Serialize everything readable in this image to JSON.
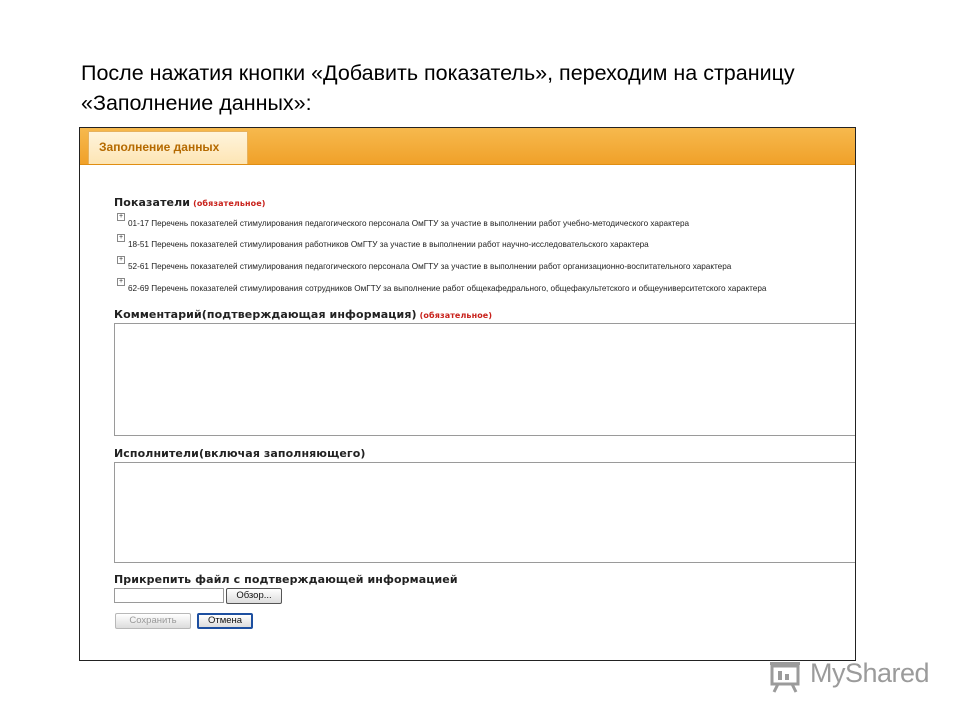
{
  "slide": {
    "title_line1": "После нажатия кнопки «Добавить показатель», переходим на страницу",
    "title_line2": "«Заполнение данных»:"
  },
  "form": {
    "tab_label": "Заполнение данных",
    "indicators_label": "Показатели",
    "required_label": "(обязательное)",
    "indicators": [
      "01-17 Перечень показателей стимулирования педагогического персонала ОмГТУ за участие в выполнении работ учебно-методического характера",
      "18-51 Перечень показателей стимулирования работников ОмГТУ за участие в выполнении работ научно-исследовательского характера",
      "52-61 Перечень показателей стимулирования педагогического персонала ОмГТУ за участие в выполнении работ организационно-воспитательного характера",
      "62-69 Перечень показателей стимулирования сотрудников ОмГТУ за выполнение работ общекафедрального, общефакультетского и общеуниверситетского характера"
    ],
    "expand_symbol": "+",
    "comment_label": "Комментарий(подтверждающая информация)",
    "executors_label": "Исполнители(включая заполняющего)",
    "attach_label": "Прикрепить файл с подтверждающей информацией",
    "file_value": "",
    "browse_button": "Обзор...",
    "save_button": "Сохранить",
    "cancel_button": "Отмена"
  },
  "watermark": {
    "text": "MyShared"
  },
  "colors": {
    "accent": "#f0a12a",
    "tab_text": "#b56a00",
    "required": "#c8211b"
  }
}
